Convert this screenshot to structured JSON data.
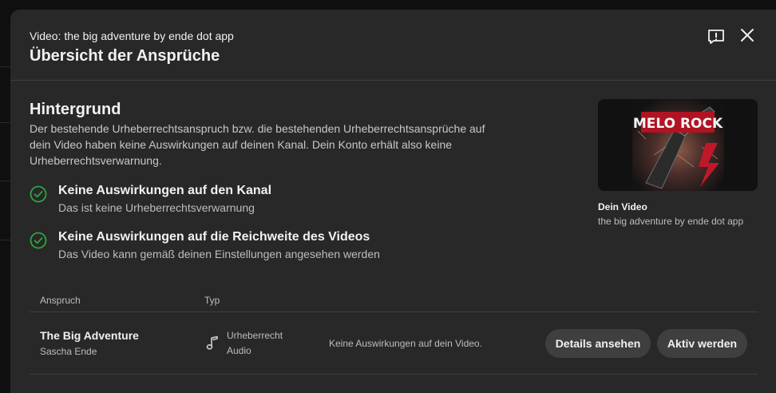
{
  "dialog": {
    "subtitle": "Video: the big adventure by ende dot app",
    "title": "Übersicht der Ansprüche",
    "feedback_icon": "feedback-icon",
    "close_icon": "close-icon"
  },
  "background": {
    "title": "Hintergrund",
    "description": "Der bestehende Urheberrechtsanspruch bzw. die bestehenden Urheberrechtsansprüche auf dein Video haben keine Auswirkungen auf deinen Kanal. Dein Konto erhält also keine Urheberrechtsverwarnung.",
    "impacts": [
      {
        "title": "Keine Auswirkungen auf den Kanal",
        "description": "Das ist keine Urheberrechtsverwarnung"
      },
      {
        "title": "Keine Auswirkungen auf die Reichweite des Videos",
        "description": "Das Video kann gemäß deinen Einstellungen angesehen werden"
      }
    ],
    "check_color": "#2ba640"
  },
  "video": {
    "thumbnail_text": "MELO ROCK",
    "label": "Dein Video",
    "name": "the big adventure by ende dot app"
  },
  "table": {
    "headers": {
      "claim": "Anspruch",
      "type": "Typ"
    },
    "rows": [
      {
        "title": "The Big Adventure",
        "owner": "Sascha Ende",
        "type_icon": "music-note-icon",
        "type": "Urheberrecht",
        "subtype": "Audio",
        "impact": "Keine Auswirkungen auf dein Video.",
        "details_label": "Details ansehen",
        "activate_label": "Aktiv werden"
      }
    ]
  },
  "colors": {
    "dialog_bg": "#282828",
    "page_bg": "#0f0f0f",
    "button_bg": "#3f3f3f",
    "divider": "#3f3f3f"
  }
}
